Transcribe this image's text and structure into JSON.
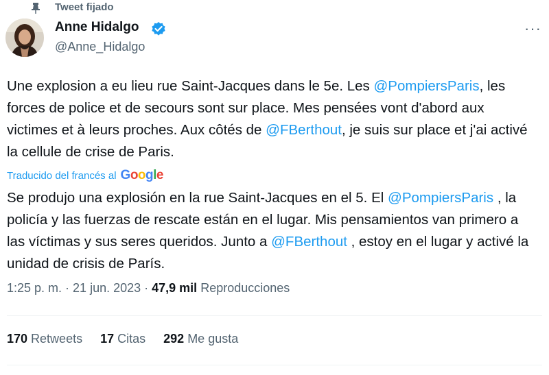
{
  "pinned": {
    "label": "Tweet fijado",
    "icon": "pin-icon"
  },
  "author": {
    "name": "Anne Hidalgo",
    "handle": "@Anne_Hidalgo",
    "verified_icon": "verified-badge-icon",
    "avatar_icon": "avatar"
  },
  "more_button": {
    "label": "···",
    "icon": "more-options-icon"
  },
  "tweet": {
    "original": {
      "t1": "Une explosion a eu lieu rue Saint-Jacques dans le 5e. Les ",
      "mention1": "@PompiersParis",
      "t2": ", les forces de police et de secours sont sur place. Mes pensées vont d'abord aux victimes et à leurs proches. Aux côtés de ",
      "mention2": "@FBerthout",
      "t3": ", je suis sur place et j'ai activé la cellule de crise de Paris."
    },
    "translated_by": "Traducido del francés al",
    "translator_brand": {
      "g1": "G",
      "o1": "o",
      "o2": "o",
      "g2": "g",
      "l": "l",
      "e": "e"
    },
    "translation": {
      "t1": "Se produjo una explosión en la rue Saint-Jacques en el 5. El ",
      "mention1": "@PompiersParis",
      "t2": " , la policía y las fuerzas de rescate están en el lugar. Mis pensamientos van primero a las víctimas y sus seres queridos. Junto a ",
      "mention2": "@FBerthout",
      "t3": " , estoy en el lugar y activé la unidad de crisis de París."
    }
  },
  "meta": {
    "time": "1:25 p. m.",
    "sep1": " · ",
    "date": "21 jun. 2023",
    "sep2": " · ",
    "views_count": "47,9 mil",
    "views_label": " Reproducciones"
  },
  "stats": {
    "retweets_count": "170",
    "retweets_label": " Retweets",
    "quotes_count": "17",
    "quotes_label": " Citas",
    "likes_count": "292",
    "likes_label": " Me gusta"
  },
  "colors": {
    "accent": "#1d9bf0",
    "secondary_text": "#536471",
    "primary_text": "#0f1419"
  }
}
